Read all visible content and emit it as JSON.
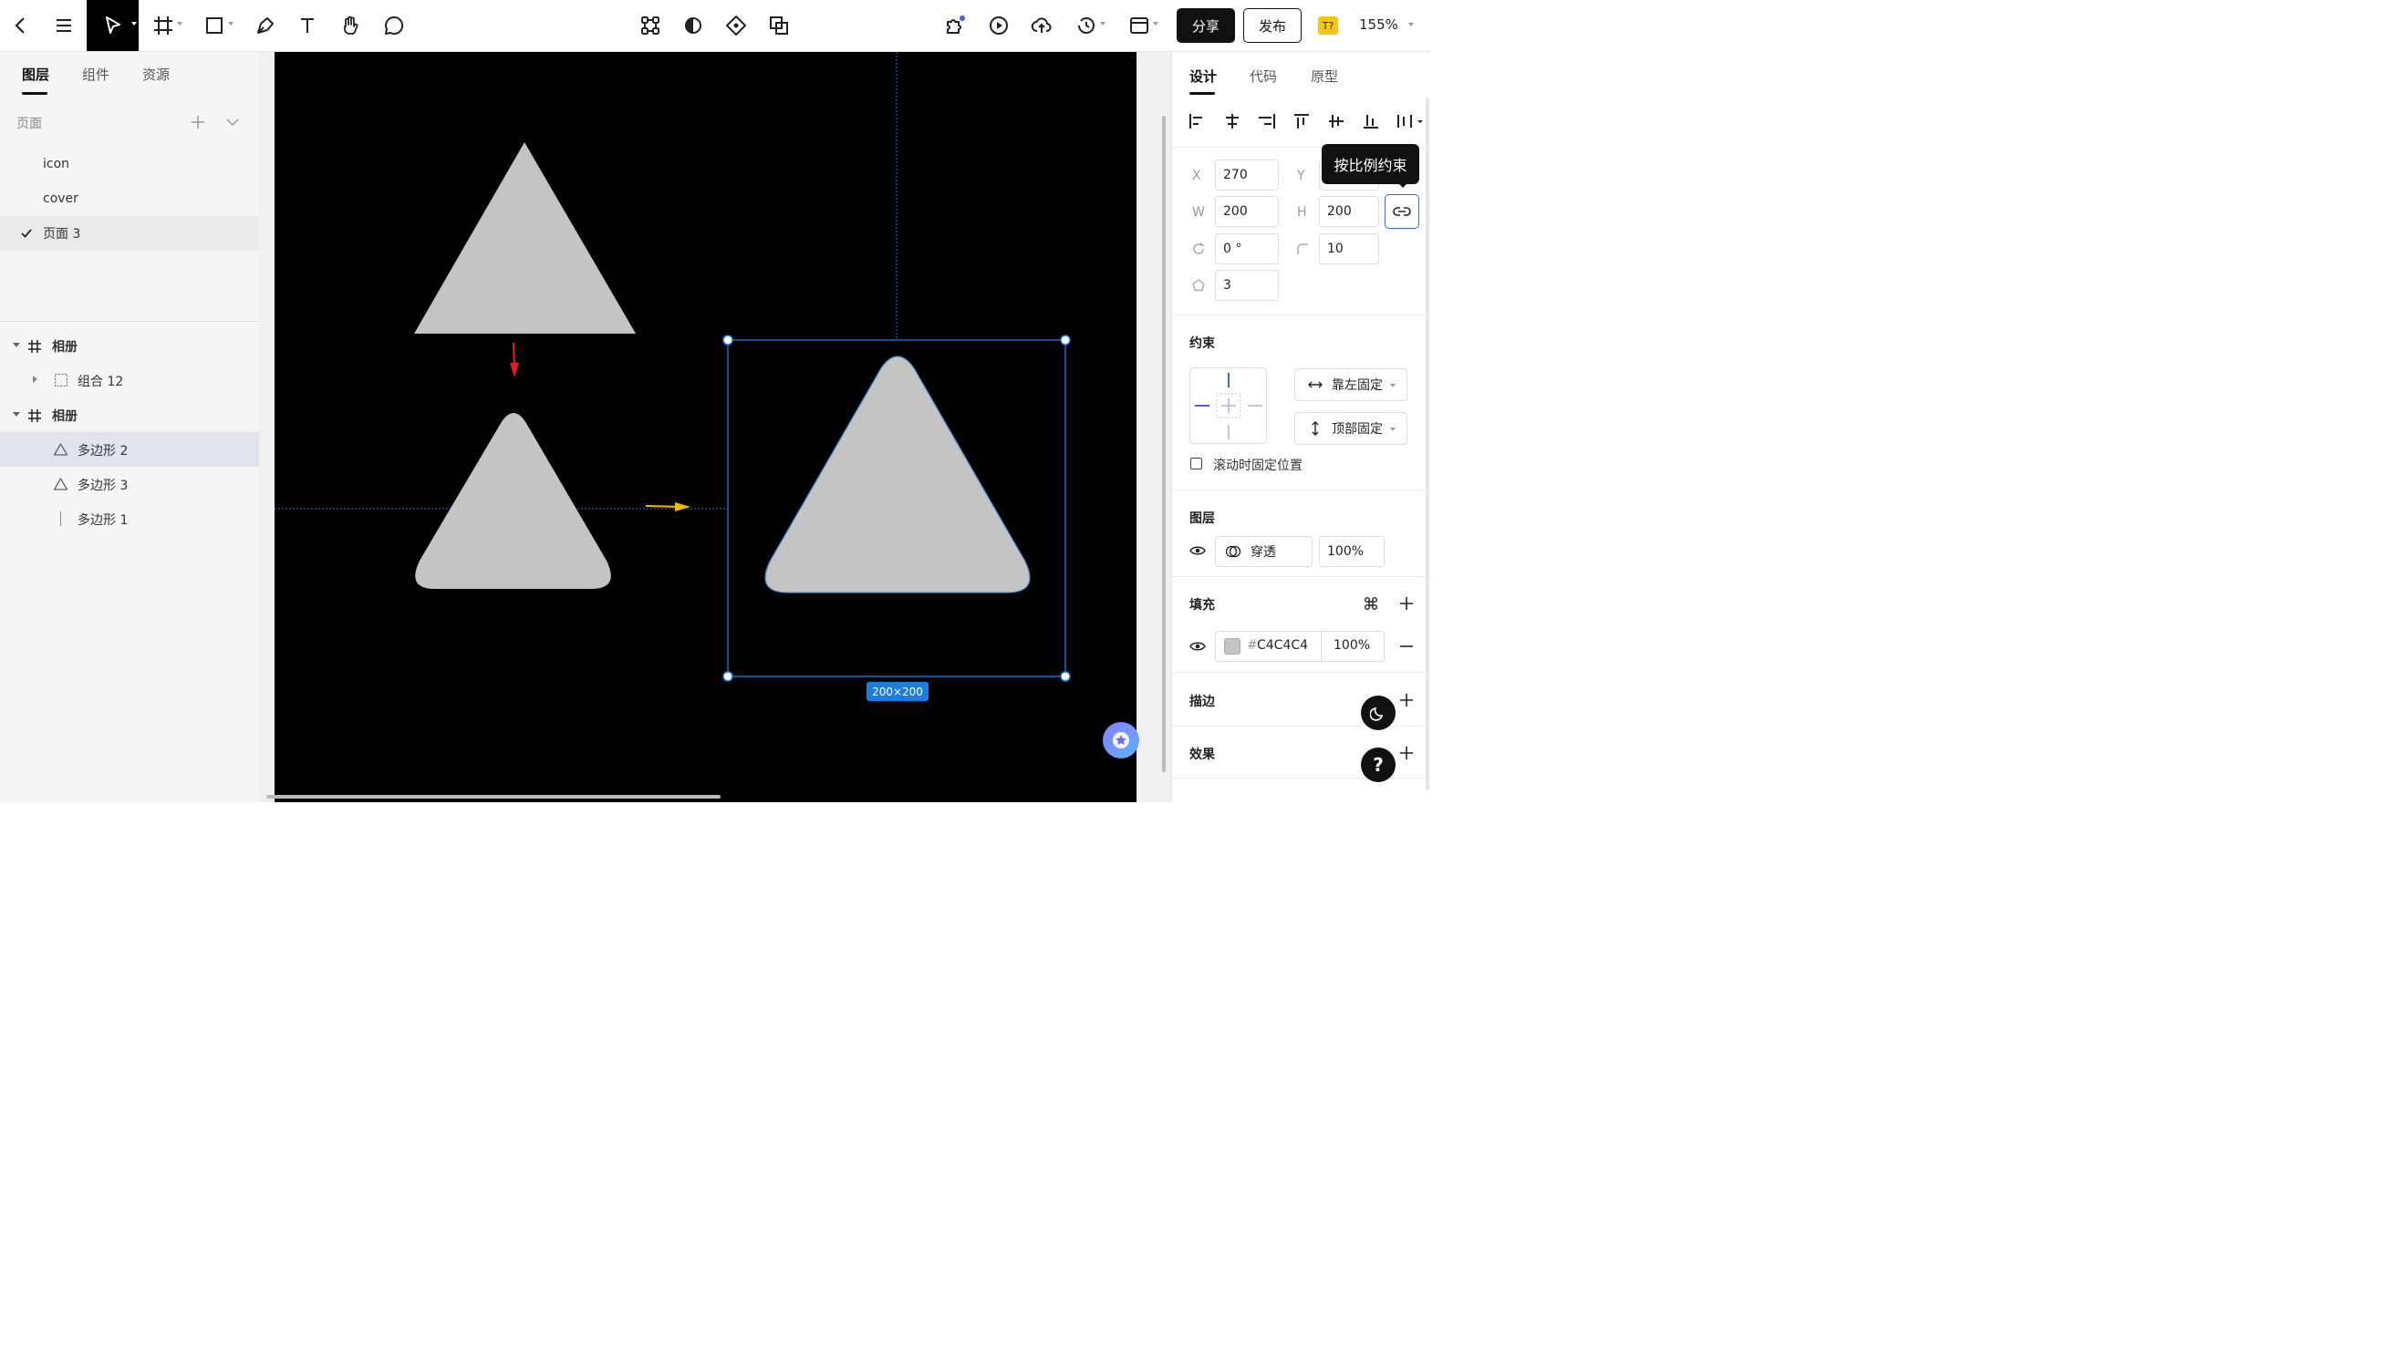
{
  "toolbar": {
    "share_label": "分享",
    "publish_label": "发布",
    "font_badge": "T?",
    "zoom": "155%"
  },
  "left_panel": {
    "tabs": [
      "图层",
      "组件",
      "资源"
    ],
    "pages_title": "页面",
    "pages": [
      "icon",
      "cover",
      "页面 3"
    ],
    "selected_page": "页面 3",
    "layers": {
      "frame1": "相册",
      "group": "组合 12",
      "frame2": "相册",
      "poly2": "多边形 2",
      "poly3": "多边形 3",
      "poly1": "多边形 1"
    }
  },
  "canvas": {
    "size_badge": "200×200"
  },
  "right_panel": {
    "tabs": [
      "设计",
      "代码",
      "原型"
    ],
    "x_label": "X",
    "x_value": "270",
    "y_label": "Y",
    "w_label": "W",
    "w_value": "200",
    "h_label": "H",
    "h_value": "200",
    "rotation": "0 °",
    "radius": "10",
    "sides": "3",
    "tooltip": "按比例约束",
    "constraints_title": "约束",
    "constraint_h": "靠左固定",
    "constraint_v": "顶部固定",
    "fixed_scroll": "滚动时固定位置",
    "layer_title": "图层",
    "blend_mode": "穿透",
    "layer_opacity": "100%",
    "fill_title": "填充",
    "fill_hash": "#",
    "fill_color": "C4C4C4",
    "fill_opacity": "100%",
    "stroke_title": "描边",
    "effects_title": "效果"
  },
  "colors": {
    "shape_fill": "#C4C4C4",
    "selection": "#1a7de0",
    "arrow_red": "#e02020",
    "arrow_yellow": "#f5b800"
  }
}
